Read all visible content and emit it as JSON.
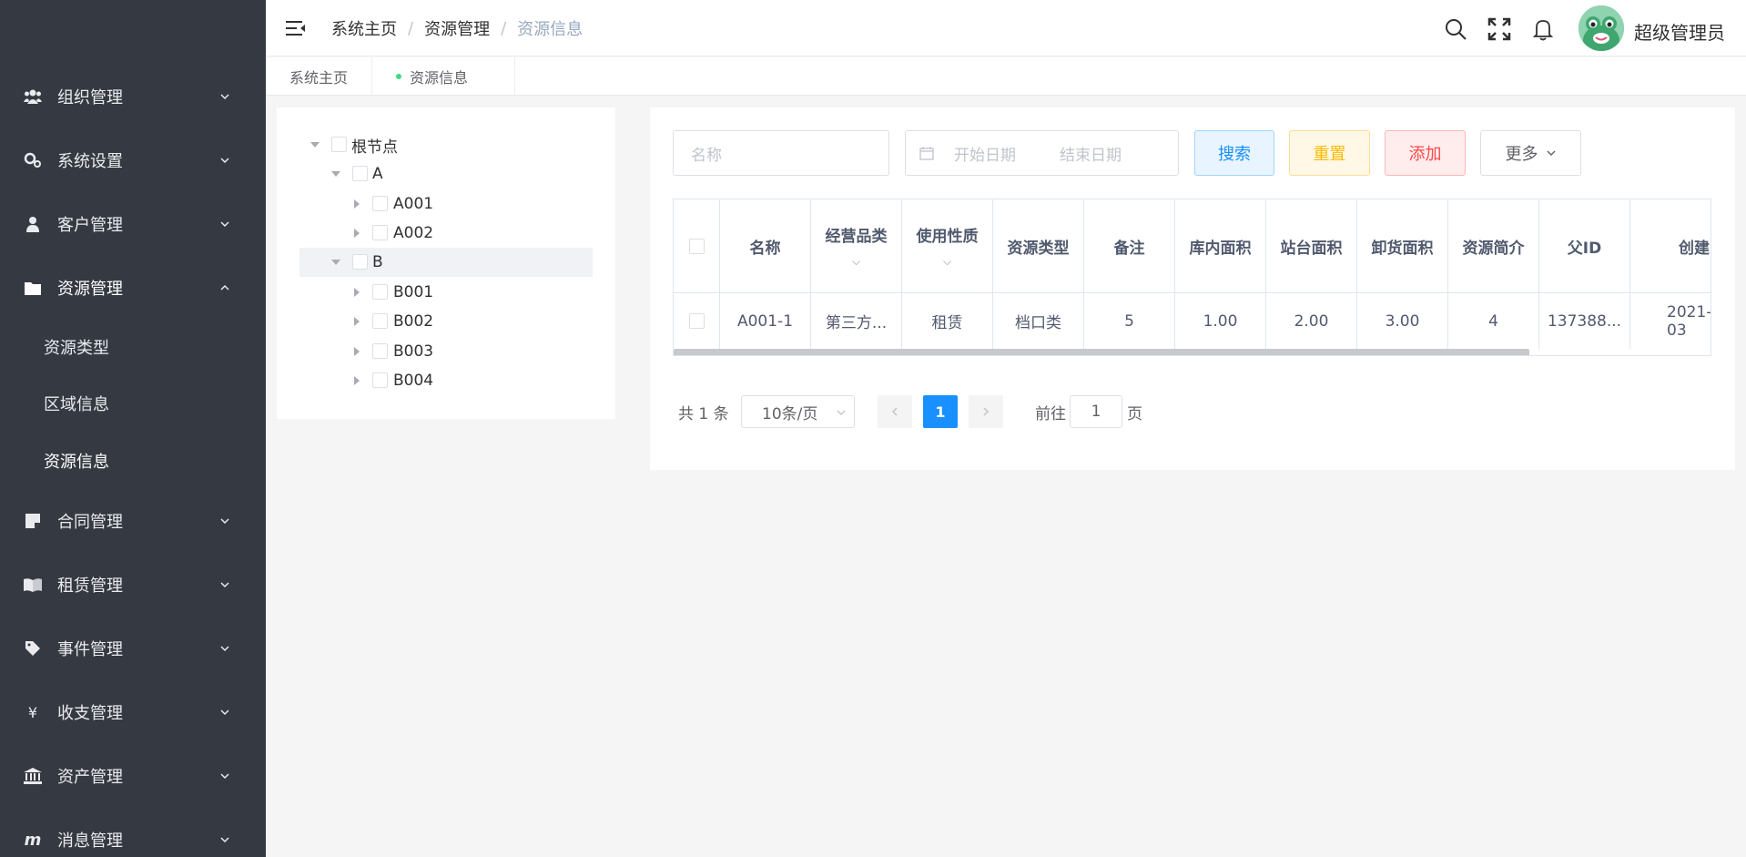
{
  "sidebar": {
    "menus": [
      {
        "label": "组织管理",
        "icon": "users-icon"
      },
      {
        "label": "系统设置",
        "icon": "gears-icon"
      },
      {
        "label": "客户管理",
        "icon": "user-icon"
      },
      {
        "label": "资源管理",
        "icon": "folder-icon"
      },
      {
        "label": "合同管理",
        "icon": "sticky-note-icon"
      },
      {
        "label": "租赁管理",
        "icon": "book-open-icon"
      },
      {
        "label": "事件管理",
        "icon": "tag-icon"
      },
      {
        "label": "收支管理",
        "icon": "yen-icon"
      },
      {
        "label": "资产管理",
        "icon": "bank-icon"
      },
      {
        "label": "消息管理",
        "icon": "m-icon"
      }
    ],
    "submenu": [
      "资源类型",
      "区域信息",
      "资源信息"
    ]
  },
  "header": {
    "breadcrumb": [
      "系统主页",
      "资源管理",
      "资源信息"
    ],
    "username": "超级管理员",
    "icons": [
      "search-icon",
      "fullscreen-icon",
      "bell-icon"
    ]
  },
  "tags": [
    "系统主页",
    "资源信息"
  ],
  "tree": {
    "nodes": [
      "根节点",
      "A",
      "A001",
      "A002",
      "B",
      "B001",
      "B002",
      "B003",
      "B004"
    ]
  },
  "filters": {
    "name_placeholder": "名称",
    "start_placeholder": "开始日期",
    "end_placeholder": "结束日期",
    "search": "搜索",
    "reset": "重置",
    "add": "添加",
    "more": "更多"
  },
  "table": {
    "headers": [
      "名称",
      "经营品类",
      "使用性质",
      "资源类型",
      "备注",
      "库内面积",
      "站台面积",
      "卸货面积",
      "资源简介",
      "父ID",
      "创建"
    ],
    "rows": [
      [
        "A001-1",
        "第三方...",
        "租赁",
        "档口类",
        "5",
        "1.00",
        "2.00",
        "3.00",
        "4",
        "137388...",
        "2021-03"
      ]
    ]
  },
  "pagination": {
    "total": "共 1 条",
    "page_size": "10条/页",
    "current": "1",
    "goto_prefix": "前往",
    "goto_value": "1",
    "goto_suffix": "页"
  },
  "colors": {
    "sidebar_bg": "#353a42",
    "primary": "#1890ff",
    "warning": "#ffba00",
    "danger": "#ff4949"
  }
}
